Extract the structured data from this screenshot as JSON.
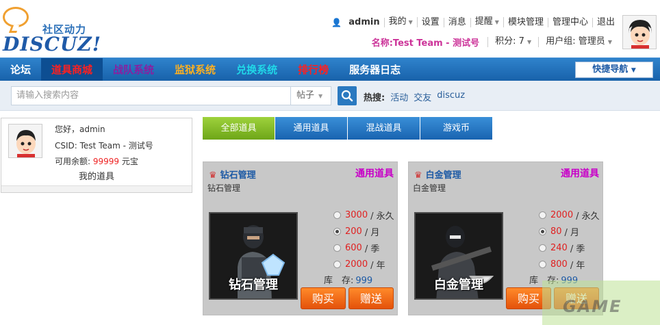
{
  "logo": {
    "sub": "社区动力",
    "main": "DISCUZ!"
  },
  "topnav": {
    "username": "admin",
    "items": [
      "我的",
      "设置",
      "消息",
      "提醒",
      "模块管理",
      "管理中心",
      "退出"
    ]
  },
  "userline": {
    "name_label": "名称:",
    "name_value": "Test Team - 测试号",
    "points": "积分: 7",
    "group": "用户组: 管理员"
  },
  "mainnav": {
    "items": [
      {
        "label": "论坛",
        "color": "#ffffff"
      },
      {
        "label": "道具商城",
        "color": "#ff2020"
      },
      {
        "label": "战队系统",
        "color": "#8a1fa0"
      },
      {
        "label": "监狱系统",
        "color": "#ffb020"
      },
      {
        "label": "兑换系统",
        "color": "#20d8e8"
      },
      {
        "label": "排行榜",
        "color": "#ff2020"
      },
      {
        "label": "服务器日志",
        "color": "#ffffff"
      }
    ],
    "quick_nav": "快捷导航"
  },
  "search": {
    "placeholder": "请输入搜索内容",
    "type": "帖子",
    "hot_label": "热搜:",
    "hot_items": [
      "活动",
      "交友",
      "discuz"
    ]
  },
  "userbox": {
    "greeting": "您好，admin",
    "csid": "CSID: Test Team - 测试号",
    "balance_label": "可用余额:",
    "balance_value": "99999",
    "balance_unit": "元宝",
    "my_items": "我的道具"
  },
  "tabs": [
    "全部道具",
    "通用道具",
    "混战道具",
    "游戏币"
  ],
  "cards": [
    {
      "name": "钻石管理",
      "type": "通用道具",
      "desc": "钻石管理",
      "pic_label": "钻石管理",
      "options": [
        {
          "price": "3000",
          "unit": "/ 永久",
          "selected": false
        },
        {
          "price": "200",
          "unit": "/ 月",
          "selected": true
        },
        {
          "price": "600",
          "unit": "/ 季",
          "selected": false
        },
        {
          "price": "2000",
          "unit": "/ 年",
          "selected": false
        }
      ],
      "stock_label": "库　存:",
      "stock_value": "999",
      "buy": "购买",
      "gift": "赠送"
    },
    {
      "name": "白金管理",
      "type": "通用道具",
      "desc": "白金管理",
      "pic_label": "白金管理",
      "options": [
        {
          "price": "2000",
          "unit": "/ 永久",
          "selected": false
        },
        {
          "price": "80",
          "unit": "/ 月",
          "selected": true
        },
        {
          "price": "240",
          "unit": "/ 季",
          "selected": false
        },
        {
          "price": "800",
          "unit": "/ 年",
          "selected": false
        }
      ],
      "stock_label": "库　存:",
      "stock_value": "999",
      "buy": "购买",
      "gift": "赠送"
    }
  ],
  "watermark": "GAME"
}
